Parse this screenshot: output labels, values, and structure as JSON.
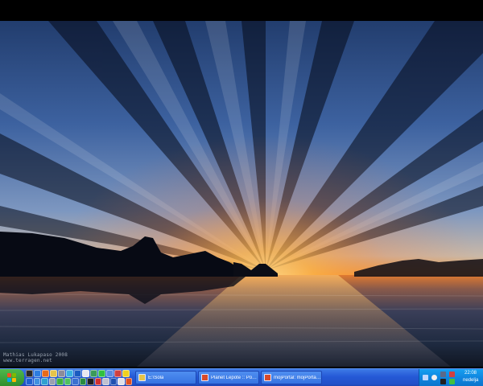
{
  "desktop": {
    "wallpaper_watermark": [
      "Mathias Lukapaso 2008",
      "www.terragen.net"
    ]
  },
  "taskbar": {
    "start_icon": "windows-flag-icon",
    "quicklaunch_icons": [
      [
        "penguin-icon",
        "globe-icon",
        "firefox-icon",
        "folder-icon",
        "gear-icon",
        "chat-icon",
        "media-icon",
        "notepad-icon",
        "image-icon",
        "green-icon",
        "network-icon",
        "palette-icon",
        "yellow-icon"
      ],
      [
        "blue-icon",
        "mail-icon",
        "globe-icon",
        "calculator-icon",
        "check-icon",
        "messenger-icon",
        "window-icon",
        "spreadsheet-icon",
        "terminal-icon",
        "warning-icon",
        "table-icon",
        "word-icon",
        "doc-icon",
        "flag-icon"
      ]
    ],
    "tasks": [
      {
        "label": "E:\\Sola",
        "icon": "folder-icon"
      },
      {
        "label": "Planet Lepote :: Pogle...",
        "icon": "browser-icon"
      },
      {
        "label": "mojPortal: mojPortal.c...",
        "icon": "browser-icon"
      }
    ],
    "tray_icons": [
      "network-icon",
      "speaker-icon",
      "monitor-icon",
      "security-icon",
      "download-icon",
      "close-icon"
    ],
    "clock": {
      "time": "22:08",
      "day": "nedelja"
    }
  },
  "colors": {
    "taskbar": "#2559d6",
    "start": "#2f8f2e",
    "tray": "#0f86e0"
  }
}
